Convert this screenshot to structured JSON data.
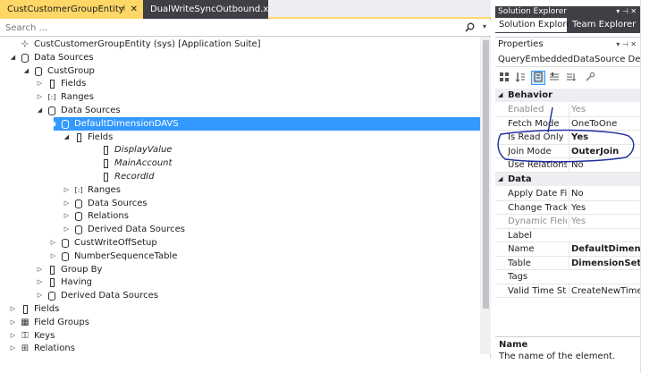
{
  "tabs": {
    "active": "CustCustomerGroupEntity",
    "active_pin": "⊣",
    "active_close": "✕",
    "inactive": "DualWriteSyncOutbound.xpp"
  },
  "search": {
    "placeholder": "Search ...",
    "icon": "search-icon"
  },
  "tree": [
    {
      "label": "CustCustomerGroupEntity (sys) [Application Suite]",
      "arrow": "",
      "icon": "entity"
    },
    {
      "label": "Data Sources",
      "arrow": "◢",
      "icon": "db"
    },
    {
      "label": "CustGroup",
      "arrow": "◢",
      "icon": "db"
    },
    {
      "label": "Fields",
      "arrow": "▷",
      "icon": "fld"
    },
    {
      "label": "Ranges",
      "arrow": "▷",
      "icon": "range"
    },
    {
      "label": "Data Sources",
      "arrow": "◢",
      "icon": "db"
    },
    {
      "label": "DefaultDimensionDAVS",
      "arrow": "◢",
      "icon": "db",
      "selected": true
    },
    {
      "label": "Fields",
      "arrow": "◢",
      "icon": "fld"
    },
    {
      "label": "DisplayValue",
      "arrow": "",
      "icon": "fld",
      "italic": true
    },
    {
      "label": "MainAccount",
      "arrow": "",
      "icon": "fld",
      "italic": true
    },
    {
      "label": "RecordId",
      "arrow": "",
      "icon": "fld",
      "italic": true
    },
    {
      "label": "Ranges",
      "arrow": "▷",
      "icon": "range"
    },
    {
      "label": "Data Sources",
      "arrow": "▷",
      "icon": "db"
    },
    {
      "label": "Relations",
      "arrow": "▷",
      "icon": "db"
    },
    {
      "label": "Derived Data Sources",
      "arrow": "▷",
      "icon": "db"
    },
    {
      "label": "CustWriteOffSetup",
      "arrow": "▷",
      "icon": "db"
    },
    {
      "label": "NumberSequenceTable",
      "arrow": "▷",
      "icon": "db"
    },
    {
      "label": "Group By",
      "arrow": "▷",
      "icon": "fld"
    },
    {
      "label": "Having",
      "arrow": "▷",
      "icon": "fld"
    },
    {
      "label": "Derived Data Sources",
      "arrow": "▷",
      "icon": "db"
    },
    {
      "label": "Fields",
      "arrow": "▷",
      "icon": "fld"
    },
    {
      "label": "Field Groups",
      "arrow": "▷",
      "icon": "grid"
    },
    {
      "label": "Keys",
      "arrow": "▷",
      "icon": "keys"
    },
    {
      "label": "Relations",
      "arrow": "▷",
      "icon": "rel"
    }
  ],
  "solution_explorer": {
    "title": "Solution Explorer",
    "controls": "▾ ⊣ ✕",
    "tab_active": "Solution Explorer",
    "tab_inactive": "Team Explorer"
  },
  "properties": {
    "title": "Properties",
    "controls": "▾ ⊣ ✕",
    "object": "QueryEmbeddedDataSource  De ▾",
    "categories": [
      {
        "name": "Behavior",
        "rows": [
          {
            "k": "Enabled",
            "v": "Yes",
            "dim": true
          },
          {
            "k": "Fetch Mode",
            "v": "OneToOne"
          },
          {
            "k": "Is Read Only",
            "v": "Yes",
            "bold": true
          },
          {
            "k": "Join Mode",
            "v": "OuterJoin",
            "bold": true
          },
          {
            "k": "Use Relations",
            "v": "No"
          }
        ]
      },
      {
        "name": "Data",
        "rows": [
          {
            "k": "Apply Date Filt",
            "v": "No"
          },
          {
            "k": "Change Trackin",
            "v": "Yes"
          },
          {
            "k": "Dynamic Fields",
            "v": "Yes",
            "dim": true
          },
          {
            "k": "Label",
            "v": ""
          },
          {
            "k": "Name",
            "v": "DefaultDimension",
            "bold": true
          },
          {
            "k": "Table",
            "v": "DimensionSetEnti",
            "bold": true
          },
          {
            "k": "Tags",
            "v": ""
          },
          {
            "k": "Valid Time Stat",
            "v": "CreateNewTimePe"
          }
        ]
      }
    ],
    "description_name": "Name",
    "description_text": "The name of the element."
  },
  "colors": {
    "selection": "#3399ff",
    "tab_active": "#ffd766",
    "tab_dark": "#3f3f46",
    "annotation": "#1f2f9f"
  }
}
